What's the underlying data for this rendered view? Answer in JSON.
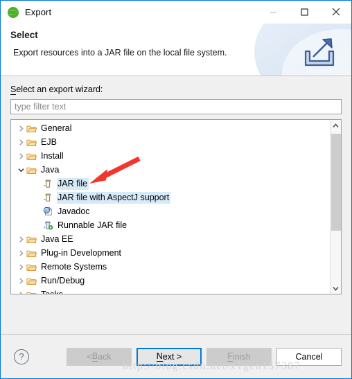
{
  "window": {
    "title": "Export",
    "app_icon": "eclipse-logo-icon",
    "minimize_label": "—",
    "maximize_label": "☐",
    "close_label": "✕"
  },
  "banner": {
    "title": "Select",
    "description": "Export resources into a JAR file on the local file system.",
    "icon": "export-tray-arrow-icon"
  },
  "form": {
    "wizard_label_prefix": "S",
    "wizard_label_rest": "elect an export wizard:",
    "filter_placeholder": "type filter text",
    "filter_value": ""
  },
  "tree": {
    "rows": [
      {
        "label": "General",
        "level": 0,
        "twisty": "collapsed",
        "icon": "folder-icon",
        "selected": false
      },
      {
        "label": "EJB",
        "level": 0,
        "twisty": "collapsed",
        "icon": "folder-icon",
        "selected": false
      },
      {
        "label": "Install",
        "level": 0,
        "twisty": "collapsed",
        "icon": "folder-icon",
        "selected": false
      },
      {
        "label": "Java",
        "level": 0,
        "twisty": "expanded",
        "icon": "folder-icon",
        "selected": false
      },
      {
        "label": "JAR file",
        "level": 1,
        "twisty": "none",
        "icon": "jar-file-icon",
        "selected": true
      },
      {
        "label": "JAR file with AspectJ support",
        "level": 1,
        "twisty": "none",
        "icon": "jar-file-icon",
        "selected": true
      },
      {
        "label": "Javadoc",
        "level": 1,
        "twisty": "none",
        "icon": "javadoc-icon",
        "selected": false
      },
      {
        "label": "Runnable JAR file",
        "level": 1,
        "twisty": "none",
        "icon": "runnable-jar-icon",
        "selected": false
      },
      {
        "label": "Java EE",
        "level": 0,
        "twisty": "collapsed",
        "icon": "folder-icon",
        "selected": false
      },
      {
        "label": "Plug-in Development",
        "level": 0,
        "twisty": "collapsed",
        "icon": "folder-icon",
        "selected": false
      },
      {
        "label": "Remote Systems",
        "level": 0,
        "twisty": "collapsed",
        "icon": "folder-icon",
        "selected": false
      },
      {
        "label": "Run/Debug",
        "level": 0,
        "twisty": "collapsed",
        "icon": "folder-icon",
        "selected": false
      },
      {
        "label": "Tasks",
        "level": 0,
        "twisty": "collapsed",
        "icon": "folder-icon",
        "selected": false
      }
    ],
    "scrollbar": {
      "up_arrow": "⌃",
      "down_arrow": "⌄"
    }
  },
  "annotation": {
    "arrow_color": "#f2352e",
    "points_to": "JAR file"
  },
  "footer": {
    "help_label": "?",
    "buttons": {
      "back": {
        "prefix": "< ",
        "accel": "B",
        "rest": "ack",
        "state": "disabled"
      },
      "next": {
        "prefix": "",
        "accel": "N",
        "rest": "ext >",
        "state": "focus"
      },
      "finish": {
        "prefix": "",
        "accel": "F",
        "rest": "inish",
        "state": "disabled"
      },
      "cancel": {
        "prefix": "",
        "accel": "",
        "rest": "Cancel",
        "state": "normal"
      }
    },
    "watermark": "http://blog.csdn.net/x1gen157387"
  },
  "colors": {
    "selection": "#d6eaf8",
    "focus_border": "#0078d7",
    "folder": "#e8a33d",
    "annotation": "#f2352e"
  }
}
